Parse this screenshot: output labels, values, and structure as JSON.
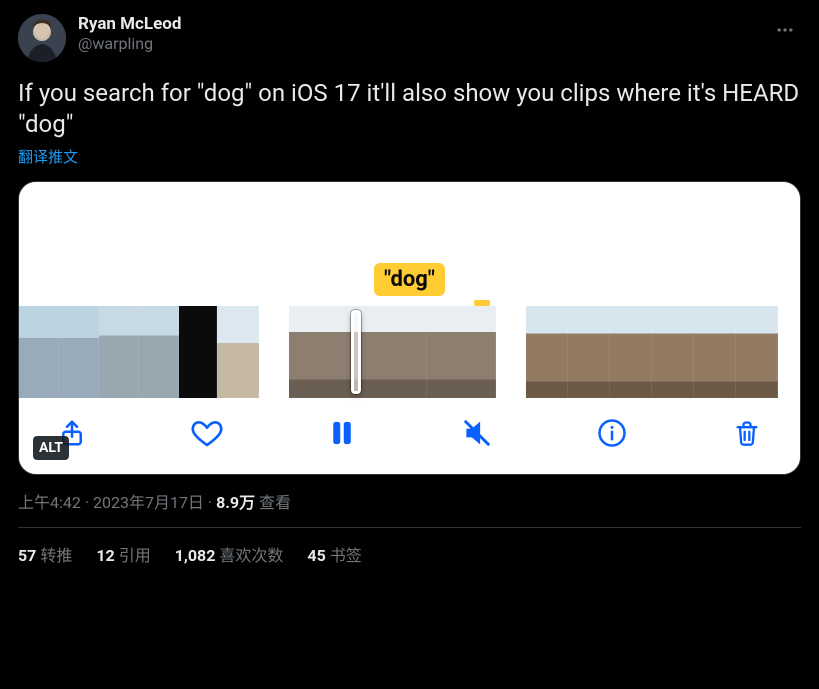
{
  "author": {
    "display_name": "Ryan McLeod",
    "handle": "@warpling"
  },
  "tweet_text": "If you search for \"dog\" on iOS 17 it'll also show you clips where it's HEARD \"dog\"",
  "translate_label": "翻译推文",
  "media": {
    "caption_bubble": "\"dog\"",
    "alt_badge": "ALT"
  },
  "meta": {
    "time": "上午4:42",
    "sep1": " · ",
    "date": "2023年7月17日",
    "sep2": " · ",
    "views_num": "8.9万",
    "views_label": " 查看"
  },
  "engagement": {
    "retweets_num": "57",
    "retweets_label": "转推",
    "quotes_num": "12",
    "quotes_label": "引用",
    "likes_num": "1,082",
    "likes_label": "喜欢次数",
    "bookmarks_num": "45",
    "bookmarks_label": "书签"
  }
}
